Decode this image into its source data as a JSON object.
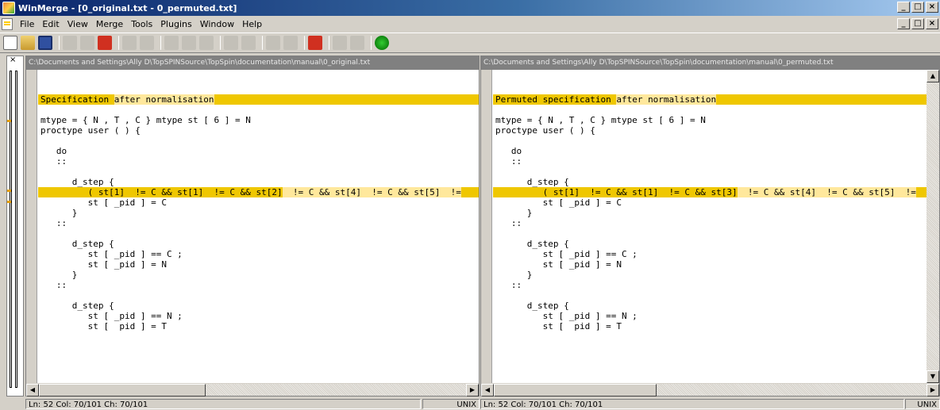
{
  "window": {
    "title": "WinMerge - [0_original.txt - 0_permuted.txt]",
    "controls": [
      "_",
      "□",
      "×"
    ]
  },
  "menu": [
    "File",
    "Edit",
    "View",
    "Merge",
    "Tools",
    "Plugins",
    "Window",
    "Help"
  ],
  "left_pane": {
    "path": "C:\\Documents and Settings\\Ally D\\TopSPINSource\\TopSpin\\documentation\\manual\\0_original.txt",
    "lines": [
      {
        "text": "",
        "diff": false
      },
      {
        "text": "",
        "diff": false
      },
      {
        "text": "Specification ",
        "hl": "after normalisation",
        "diff": true
      },
      {
        "text": "",
        "diff": false
      },
      {
        "text": "mtype = { N , T , C } mtype st [ 6 ] = N",
        "diff": false
      },
      {
        "text": "proctype user ( ) {",
        "diff": false
      },
      {
        "text": "",
        "diff": false
      },
      {
        "text": "   do",
        "diff": false
      },
      {
        "text": "   ::",
        "diff": false
      },
      {
        "text": "",
        "diff": false
      },
      {
        "text": "      d_step {",
        "diff": false
      },
      {
        "text": "         ( st[1]  != C && st[1]  != C && ",
        "mid": "st[2]",
        "tail": "  != C && st[4]  != C && st[5]  !=",
        "diff": true,
        "marker": true
      },
      {
        "text": "         st [ _pid ] = C",
        "diff": false
      },
      {
        "text": "      }",
        "diff": false
      },
      {
        "text": "   ::",
        "diff": false
      },
      {
        "text": "",
        "diff": false
      },
      {
        "text": "      d_step {",
        "diff": false
      },
      {
        "text": "         st [ _pid ] == C ;",
        "diff": false
      },
      {
        "text": "         st [ _pid ] = N",
        "diff": false
      },
      {
        "text": "      }",
        "diff": false
      },
      {
        "text": "   ::",
        "diff": false
      },
      {
        "text": "",
        "diff": false
      },
      {
        "text": "      d_step {",
        "diff": false
      },
      {
        "text": "         st [ _pid ] == N ;",
        "diff": false
      },
      {
        "text": "         st [  pid ] = T",
        "diff": false
      }
    ]
  },
  "right_pane": {
    "path": "C:\\Documents and Settings\\Ally D\\TopSPINSource\\TopSpin\\documentation\\manual\\0_permuted.txt",
    "lines": [
      {
        "text": "",
        "diff": false
      },
      {
        "text": "",
        "diff": false
      },
      {
        "text": "Permuted specification ",
        "hl": "after normalisation",
        "diff": true
      },
      {
        "text": "",
        "diff": false
      },
      {
        "text": "mtype = { N , T , C } mtype st [ 6 ] = N",
        "diff": false
      },
      {
        "text": "proctype user ( ) {",
        "diff": false
      },
      {
        "text": "",
        "diff": false
      },
      {
        "text": "   do",
        "diff": false
      },
      {
        "text": "   ::",
        "diff": false
      },
      {
        "text": "",
        "diff": false
      },
      {
        "text": "      d_step {",
        "diff": false
      },
      {
        "text": "         ( st[1]  != C && st[1]  != C && ",
        "mid": "st[3]",
        "tail": "  != C && st[4]  != C && st[5]  !=",
        "diff": true,
        "marker": true
      },
      {
        "text": "         st [ _pid ] = C",
        "diff": false
      },
      {
        "text": "      }",
        "diff": false
      },
      {
        "text": "   ::",
        "diff": false
      },
      {
        "text": "",
        "diff": false
      },
      {
        "text": "      d_step {",
        "diff": false
      },
      {
        "text": "         st [ _pid ] == C ;",
        "diff": false
      },
      {
        "text": "         st [ _pid ] = N",
        "diff": false
      },
      {
        "text": "      }",
        "diff": false
      },
      {
        "text": "   ::",
        "diff": false
      },
      {
        "text": "",
        "diff": false
      },
      {
        "text": "      d_step {",
        "diff": false
      },
      {
        "text": "         st [ _pid ] == N ;",
        "diff": false
      },
      {
        "text": "         st [  pid ] = T",
        "diff": false
      }
    ]
  },
  "status": {
    "left_pos": "Ln: 52  Col: 70/101  Ch: 70/101",
    "left_eol": "UNIX",
    "right_pos": "Ln: 52  Col: 70/101  Ch: 70/101",
    "right_eol": "UNIX"
  },
  "colors": {
    "diff": "#efc700",
    "diff_word": "#ffe89c",
    "title_start": "#0a246a"
  }
}
